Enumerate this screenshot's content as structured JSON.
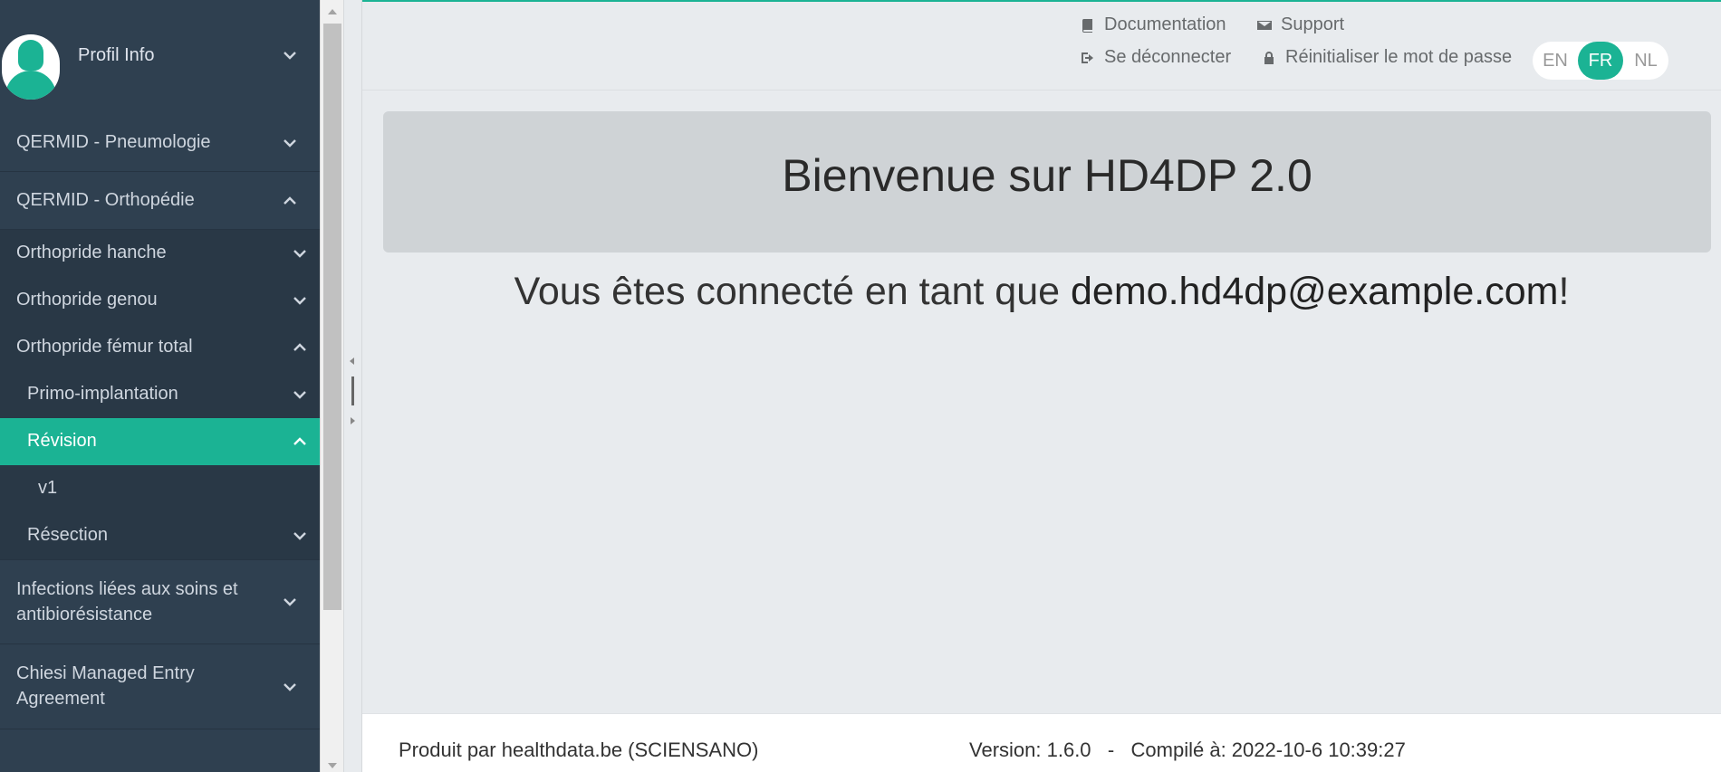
{
  "profile": {
    "label": "Profil Info"
  },
  "sidebar": {
    "items": [
      {
        "label": "QERMID - Pneumologie"
      },
      {
        "label": "QERMID - Orthopédie"
      },
      {
        "label": "Orthopride hanche"
      },
      {
        "label": "Orthopride genou"
      },
      {
        "label": "Orthopride fémur total"
      },
      {
        "label": "Primo-implantation"
      },
      {
        "label": "Révision"
      },
      {
        "label": "v1"
      },
      {
        "label": "Résection"
      },
      {
        "label": "Infections liées aux soins et antibiorésistance"
      },
      {
        "label": "Chiesi Managed Entry Agreement"
      }
    ]
  },
  "header": {
    "documentation": "Documentation",
    "support": "Support",
    "logout": "Se déconnecter",
    "reset_password": "Réinitialiser le mot de passe",
    "languages": [
      "EN",
      "FR",
      "NL"
    ],
    "selected_language": "FR"
  },
  "main": {
    "title": "Bienvenue sur HD4DP 2.0",
    "logged_in_prefix": "Vous êtes connecté en tant que ",
    "user_email": "demo.hd4dp@example.com",
    "logged_in_suffix": "!"
  },
  "footer": {
    "producer": "Produit par healthdata.be (SCIENSANO)",
    "version": "Version: 1.6.0   -   Compilé à: 2022-10-6 10:39:27"
  },
  "colors": {
    "accent": "#1bb394",
    "sidebar_bg": "#2f4050"
  },
  "icons": [
    "user-avatar-icon",
    "chevron-down-icon",
    "chevron-up-icon",
    "book-icon",
    "envelope-icon",
    "sign-out-icon",
    "lock-icon"
  ]
}
